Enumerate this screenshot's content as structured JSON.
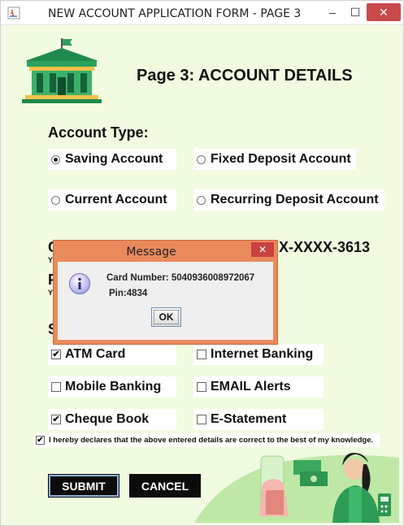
{
  "window": {
    "title": "NEW ACCOUNT APPLICATION FORM - PAGE 3",
    "minimize_glyph": "–",
    "maximize_glyph": "☐",
    "close_glyph": "✕"
  },
  "header": {
    "title": "Page 3: ACCOUNT DETAILS",
    "logo": "bank-building-icon"
  },
  "account_type": {
    "label": "Account Type:",
    "options": [
      {
        "label": "Saving Account",
        "selected": true
      },
      {
        "label": "Fixed Deposit Account",
        "selected": false
      },
      {
        "label": "Current Account",
        "selected": false
      },
      {
        "label": "Recurring Deposit Account",
        "selected": false
      }
    ]
  },
  "obscured": {
    "card_row_initial": "C",
    "card_number_suffix": "X-XXXX-3613",
    "card_hint_initial": "Y",
    "pin_row_initial": "P",
    "pin_hint_initial": "Y",
    "services_initial": "S"
  },
  "services": {
    "options": [
      {
        "label": "ATM Card",
        "checked": true
      },
      {
        "label": "Internet Banking",
        "checked": false
      },
      {
        "label": "Mobile Banking",
        "checked": false
      },
      {
        "label": "EMAIL Alerts",
        "checked": false
      },
      {
        "label": "Cheque Book",
        "checked": true
      },
      {
        "label": "E-Statement",
        "checked": false
      }
    ]
  },
  "declaration": {
    "text": "I hereby declares that the above entered details are correct to the best of my knowledge.",
    "checked": true
  },
  "buttons": {
    "submit": "SUBMIT",
    "cancel": "CANCEL"
  },
  "dialog": {
    "title": "Message",
    "close_glyph": "✕",
    "card_line": "Card Number: 5040936008972067",
    "pin_line": "Pin:4834",
    "ok": "OK",
    "icon": "info-icon"
  },
  "colors": {
    "background": "#f0fbe0",
    "dialog_frame": "#e98a5c",
    "close_red": "#c94a4a",
    "button_dark": "#0c0c0c"
  }
}
